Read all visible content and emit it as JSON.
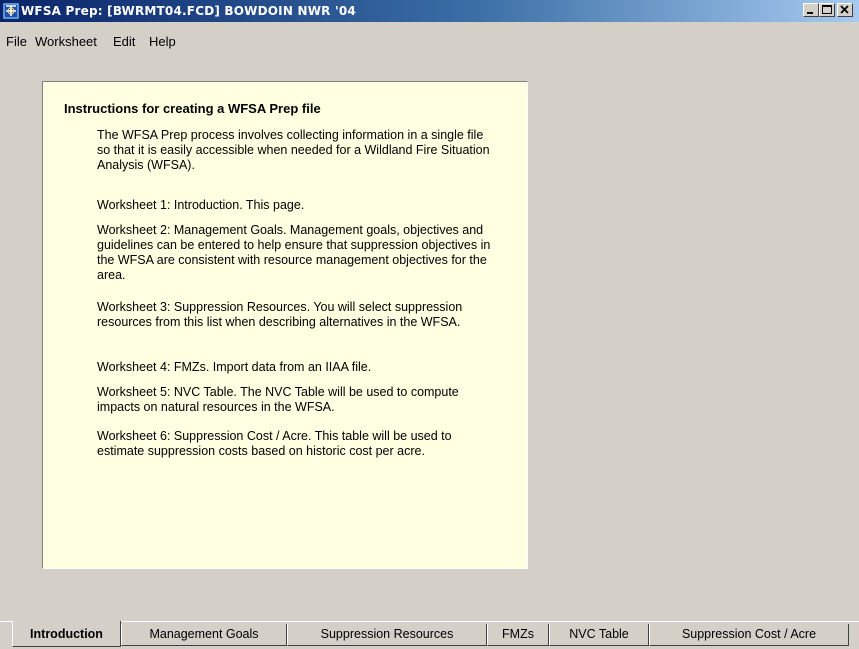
{
  "window": {
    "title": "WFSA Prep: [BWRMT04.FCD]  BOWDOIN NWR '04",
    "app_icon": "wfsa-app-icon",
    "buttons": [
      "minimize-icon",
      "maximize-icon",
      "close-icon"
    ]
  },
  "menu": {
    "file": "File",
    "worksheet": "Worksheet",
    "edit": "Edit",
    "help": "Help"
  },
  "instructions": {
    "heading": "Instructions for creating a WFSA Prep file",
    "paragraphs": [
      "The WFSA Prep process involves collecting information in a single file so that it is easily accessible when needed for a Wildland Fire Situation Analysis (WFSA).",
      "Worksheet 1: Introduction.  This page.",
      "Worksheet 2: Management Goals.  Management goals, objectives and guidelines can be entered to help ensure that suppression objectives in the WFSA are consistent with resource management objectives for the area.",
      "Worksheet 3: Suppression Resources.  You will select suppression resources from this list when describing alternatives in the WFSA.",
      "Worksheet 4: FMZs.  Import data from an IIAA file.",
      "Worksheet 5: NVC Table.  The NVC Table will be used to compute impacts on natural resources in the WFSA.",
      "Worksheet 6: Suppression Cost / Acre.  This table will be used to estimate suppression costs based on historic cost per acre."
    ]
  },
  "tabs": [
    {
      "label": "Introduction",
      "active": true
    },
    {
      "label": "Management Goals",
      "active": false
    },
    {
      "label": "Suppression Resources",
      "active": false
    },
    {
      "label": "FMZs",
      "active": false
    },
    {
      "label": "NVC Table",
      "active": false
    },
    {
      "label": "Suppression Cost / Acre",
      "active": false
    }
  ],
  "colors": {
    "titlebar_start": "#0a246a",
    "titlebar_end": "#a6caf0",
    "panel_bg": "#ffffe1",
    "window_bg": "#d4d0c8"
  }
}
